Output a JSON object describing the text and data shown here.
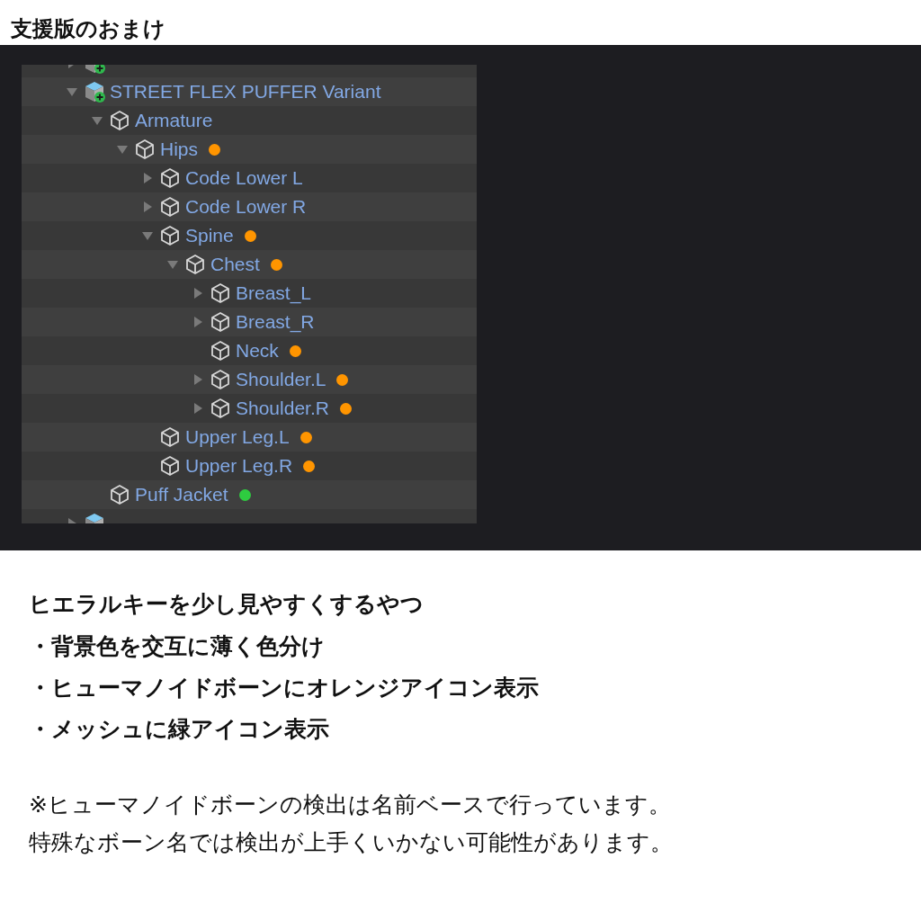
{
  "title": "支援版のおまけ",
  "hierarchy": [
    {
      "kind": "prefab",
      "expanded": false
    },
    {
      "label": "STREET FLEX PUFFER Variant",
      "kind": "prefab",
      "expanded": true,
      "children": [
        {
          "label": "Armature",
          "kind": "object",
          "expanded": true,
          "children": [
            {
              "label": "Hips",
              "kind": "object",
              "expanded": true,
              "color": "#ff9500",
              "children": [
                {
                  "label": "Code Lower L",
                  "kind": "object",
                  "expanded": false
                },
                {
                  "label": "Code Lower R",
                  "kind": "object",
                  "expanded": false
                },
                {
                  "label": "Spine",
                  "kind": "object",
                  "expanded": true,
                  "color": "#ff9500",
                  "children": [
                    {
                      "label": "Chest",
                      "kind": "object",
                      "expanded": true,
                      "color": "#ff9500",
                      "children": [
                        {
                          "label": "Breast_L",
                          "kind": "object",
                          "expanded": false
                        },
                        {
                          "label": "Breast_R",
                          "kind": "object",
                          "expanded": false
                        },
                        {
                          "label": "Neck",
                          "kind": "object",
                          "color": "#ff9500"
                        },
                        {
                          "label": "Shoulder.L",
                          "kind": "object",
                          "expanded": false,
                          "color": "#ff9500"
                        },
                        {
                          "label": "Shoulder.R",
                          "kind": "object",
                          "expanded": false,
                          "color": "#ff9500"
                        }
                      ]
                    }
                  ]
                },
                {
                  "label": "Upper Leg.L",
                  "kind": "object",
                  "color": "#ff9500"
                },
                {
                  "label": "Upper Leg.R",
                  "kind": "object",
                  "color": "#ff9500"
                }
              ]
            }
          ]
        },
        {
          "label": "Puff Jacket",
          "kind": "object",
          "color": "#2ecc40"
        }
      ]
    },
    {
      "kind": "prefab",
      "expanded": false
    }
  ],
  "heading": "ヒエラルキーを少し見やすくするやつ",
  "bullets": [
    "・背景色を交互に薄く色分け",
    "・ヒューマノイドボーンにオレンジアイコン表示",
    "・メッシュに緑アイコン表示"
  ],
  "notes": [
    "※ヒューマノイドボーンの検出は名前ベースで行っています。",
    "特殊なボーン名では検出が上手くいかない可能性があります。"
  ]
}
